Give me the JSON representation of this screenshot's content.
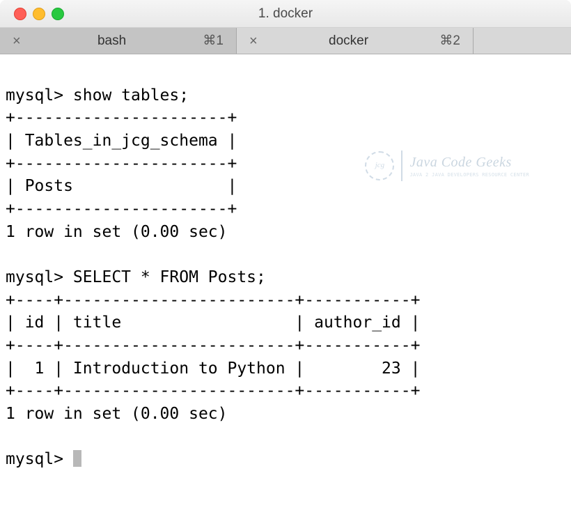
{
  "window": {
    "title": "1. docker"
  },
  "tabs": [
    {
      "label": "bash",
      "shortcut": "⌘1",
      "active": false
    },
    {
      "label": "docker",
      "shortcut": "⌘2",
      "active": true
    }
  ],
  "terminal": {
    "prompt": "mysql>",
    "line1": "mysql> show tables;",
    "line2": "+----------------------+",
    "line3": "| Tables_in_jcg_schema |",
    "line4": "+----------------------+",
    "line5": "| Posts                |",
    "line6": "+----------------------+",
    "line7": "1 row in set (0.00 sec)",
    "line8": "",
    "line9": "mysql> SELECT * FROM Posts;",
    "line10": "+----+------------------------+-----------+",
    "line11": "| id | title                  | author_id |",
    "line12": "+----+------------------------+-----------+",
    "line13": "|  1 | Introduction to Python |        23 |",
    "line14": "+----+------------------------+-----------+",
    "line15": "1 row in set (0.00 sec)",
    "line16": "",
    "line17": "mysql> "
  },
  "watermark": {
    "logo": "jcg",
    "title": "Java Code Geeks",
    "subtitle": "JAVA 2 JAVA DEVELOPERS RESOURCE CENTER"
  }
}
